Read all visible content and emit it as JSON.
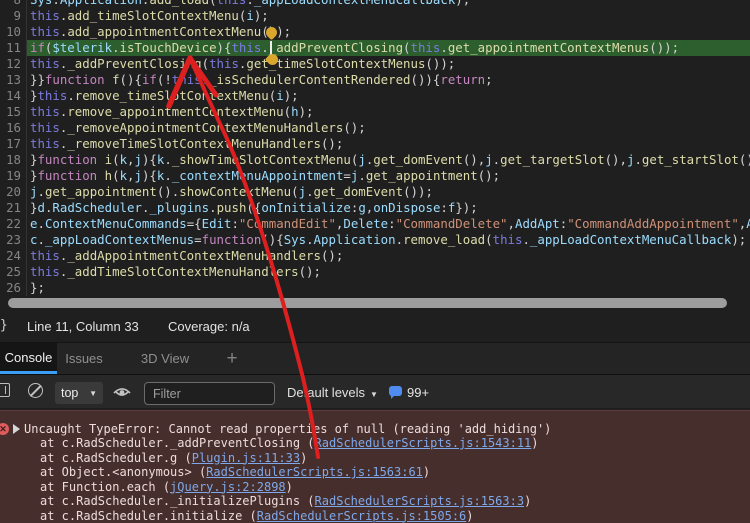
{
  "editor": {
    "active_line": 11,
    "caret": {
      "line": 11,
      "column": 33
    },
    "lines": [
      {
        "n": 8,
        "code": "Sys.Application.add_load(this._appLoadContextMenuCallback);"
      },
      {
        "n": 9,
        "code": "this.add_timeSlotContextMenu(i);"
      },
      {
        "n": 10,
        "code": "this.add_appointmentContextMenu(h);"
      },
      {
        "n": 11,
        "code": "if($telerik.isTouchDevice){this._addPreventClosing(this.get_appointmentContextMenus());"
      },
      {
        "n": 12,
        "code": "this._addPreventClosing(this.get_timeSlotContextMenus());"
      },
      {
        "n": 13,
        "code": "}}function f(){if(!this._isSchedulerContentRendered()){return;"
      },
      {
        "n": 14,
        "code": "}this.remove_timeSlotContextMenu(i);"
      },
      {
        "n": 15,
        "code": "this.remove_appointmentContextMenu(h);"
      },
      {
        "n": 16,
        "code": "this._removeAppointmentContextMenuHandlers();"
      },
      {
        "n": 17,
        "code": "this._removeTimeSlotContextMenuHandlers();"
      },
      {
        "n": 18,
        "code": "}function i(k,j){k._showTimeSlotContextMenu(j.get_domEvent(),j.get_targetSlot(),j.get_startSlot()"
      },
      {
        "n": 19,
        "code": "}function h(k,j){k._contextMenuAppointment=j.get_appointment();"
      },
      {
        "n": 20,
        "code": "j.get_appointment().showContextMenu(j.get_domEvent());"
      },
      {
        "n": 21,
        "code": "}d.RadScheduler._plugins.push({onInitialize:g,onDispose:f});"
      },
      {
        "n": 22,
        "code": "e.ContextMenuCommands={Edit:\"CommandEdit\",Delete:\"CommandDelete\",AddApt:\"CommandAddAppointment\",A"
      },
      {
        "n": 23,
        "code": "c._appLoadContextMenus=function(){Sys.Application.remove_load(this._appLoadContextMenuCallback);"
      },
      {
        "n": 24,
        "code": "this._addAppointmentContextMenuHandlers();"
      },
      {
        "n": 25,
        "code": "this._addTimeSlotContextMenuHandlers();"
      },
      {
        "n": 26,
        "code": "};"
      }
    ]
  },
  "status_bar": {
    "format_button": "{}",
    "position": "Line 11, Column 33",
    "coverage": "Coverage: n/a"
  },
  "tabs": {
    "console": "Console",
    "issues": "Issues",
    "view3d": "3D View",
    "new_tab": "+"
  },
  "toolbar": {
    "context": "top",
    "context_caret": "▼",
    "filter_placeholder": "Filter",
    "levels": "Default levels",
    "levels_caret": "▼",
    "badge": "99+"
  },
  "console": {
    "error_icon": "✕",
    "message": "Uncaught TypeError: Cannot read properties of null (reading 'add_hiding')",
    "stack": [
      {
        "pre": "at c.RadScheduler._addPreventClosing (",
        "link": "RadSchedulerScripts.js:1543:11",
        "suf": ")"
      },
      {
        "pre": "at c.RadScheduler.g (",
        "link": "Plugin.js:11:33",
        "suf": ")"
      },
      {
        "pre": "at Object.<anonymous> (",
        "link": "RadSchedulerScripts.js:1563:61",
        "suf": ")"
      },
      {
        "pre": "at Function.each (",
        "link": "jQuery.js:2:2898",
        "suf": ")"
      },
      {
        "pre": "at c.RadScheduler._initializePlugins (",
        "link": "RadSchedulerScripts.js:1563:3",
        "suf": ")"
      },
      {
        "pre": "at c.RadScheduler.initialize (",
        "link": "RadSchedulerScripts.js:1505:6",
        "suf": ")"
      }
    ]
  },
  "colors": {
    "accent": "#3ba0f5",
    "execline": "#2d5e2d",
    "arrow": "#dd1f1f",
    "marker": "#d9a62e",
    "errbg": "#452e2c",
    "errtext": "#efdbda",
    "link": "#7fa8ea",
    "kw": "#c586c0",
    "this": "#7b7bdf",
    "fn": "#dcdcaa",
    "var": "#9cdcfe",
    "punct": "#d4d4d4",
    "str": "#ce9178",
    "linenum": "#858585"
  }
}
